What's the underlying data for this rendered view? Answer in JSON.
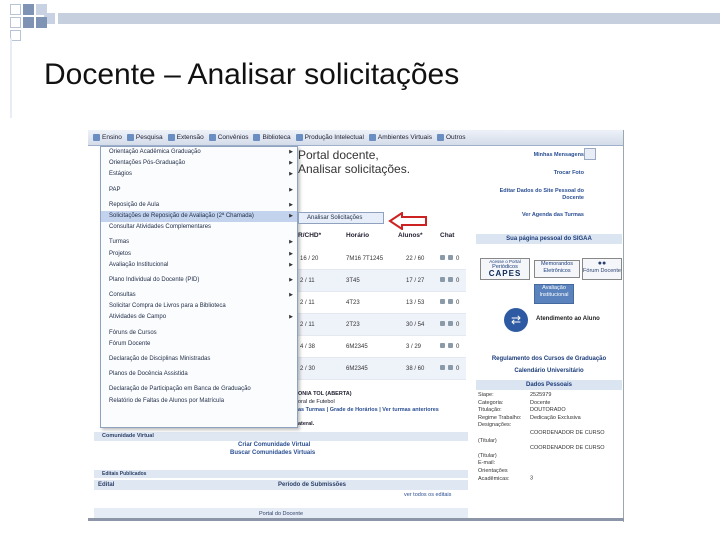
{
  "slide": {
    "title": "Docente – Analisar solicitações",
    "callout": [
      "Portal docente,",
      "Analisar solicitações."
    ]
  },
  "topnav": {
    "items": [
      "Ensino",
      "Pesquisa",
      "Extensão",
      "Convênios",
      "Biblioteca",
      "Produção Intelectual",
      "Ambientes Virtuais",
      "Outros"
    ]
  },
  "menu": {
    "items": [
      {
        "label": "Orientação Acadêmica   Graduação",
        "arrow": true
      },
      {
        "label": "Orientações Pós-Graduação",
        "arrow": true
      },
      {
        "label": "Estágios",
        "arrow": true
      },
      {
        "label": "",
        "arrow": false
      },
      {
        "label": "PAP",
        "arrow": true
      },
      {
        "label": "",
        "arrow": false
      },
      {
        "label": "Reposição de Aula",
        "arrow": true
      },
      {
        "label": "Solicitações de Reposição de Avaliação (2ª Chamada)",
        "arrow": true,
        "highlight": true
      },
      {
        "label": "Consultar Atividades Complementares",
        "arrow": false
      },
      {
        "label": "",
        "arrow": false
      },
      {
        "label": "Turmas",
        "arrow": true
      },
      {
        "label": "Projetos",
        "arrow": true
      },
      {
        "label": "Avaliação Institucional",
        "arrow": true
      },
      {
        "label": "",
        "arrow": false
      },
      {
        "label": "Plano Individual do Docente (PID)",
        "arrow": true
      },
      {
        "label": "",
        "arrow": false
      },
      {
        "label": "Consultas",
        "arrow": true
      },
      {
        "label": "Solicitar Compra de Livros para a Biblioteca",
        "arrow": false
      },
      {
        "label": "Atividades de Campo",
        "arrow": true
      },
      {
        "label": "",
        "arrow": false
      },
      {
        "label": "Fóruns de Cursos",
        "arrow": false
      },
      {
        "label": "Fórum Docente",
        "arrow": false
      },
      {
        "label": "",
        "arrow": false
      },
      {
        "label": "Declaração de Disciplinas Ministradas",
        "arrow": false
      },
      {
        "label": "",
        "arrow": false
      },
      {
        "label": "Planos de Docência Assistida",
        "arrow": false
      },
      {
        "label": "",
        "arrow": false
      },
      {
        "label": "Declaração de Participação em Banca de Graduação",
        "arrow": false
      },
      {
        "label": "Relatório de Faltas de Alunos por Matrícula",
        "arrow": false
      }
    ],
    "submenu_label": "Analisar Solicitações"
  },
  "table": {
    "headers": [
      "R/CHD*",
      "Horário",
      "Alunos*",
      "Chat"
    ],
    "rows": [
      {
        "a": "16 / 20",
        "b": "7M16 7T1245",
        "c": "22 / 60",
        "d": "0"
      },
      {
        "a": "2 / 11",
        "b": "3T45",
        "c": "17 / 27",
        "d": "0"
      },
      {
        "a": "2 / 11",
        "b": "4T23",
        "c": "13 / 53",
        "d": "0"
      },
      {
        "a": "2 / 11",
        "b": "2T23",
        "c": "30 / 54",
        "d": "0"
      },
      {
        "a": "4 / 38",
        "b": "6M2345",
        "c": "3 / 29",
        "d": "0"
      },
      {
        "a": "2 / 30",
        "b": "6M2345",
        "c": "38 / 60",
        "d": "0"
      }
    ],
    "turmas_text": "ONIA   TOL (ABERTA)",
    "turmas_text2": "oral de Futebol",
    "turmas_links": "as Turmas  |  Grade de Horários  |  Ver turmas anteriores",
    "turmas_footer": "ateral."
  },
  "lower": {
    "comunidade_title": "Comunidade Virtual",
    "criar": "Criar Comunidade Virtual",
    "buscar": "Buscar Comunidades Virtuais",
    "editais_title": "Editais Publicados",
    "edital_col": "Edital",
    "periodo_col": "Período de Submissões",
    "ver_todos": "ver todos os editais",
    "portal_footer": "Portal do Docente"
  },
  "right": {
    "links": [
      "Minhas Mensagens",
      "Trocar Foto",
      "Editar Dados do Site Pessoal do Docente",
      "Ver Agenda das Turmas"
    ],
    "pagina_pessoal": "Sua página pessoal do SIGAA",
    "capes_top": "Acesse o Portal",
    "capes_mid": "Periódicos",
    "capes_logo": "CAPES",
    "memo": "Memorandos Eletrônicos",
    "forum": "Fórum Docente",
    "aval": "Avaliação Institucional",
    "atendimento": "Atendimento ao Aluno",
    "regulamento": "Regulamento dos Cursos de Graduação",
    "calendario": "Calendário Universitário",
    "dados_title": "Dados Pessoais",
    "dados": [
      {
        "k": "Siape:",
        "v": "2525979"
      },
      {
        "k": "Categoria:",
        "v": "Docente"
      },
      {
        "k": "Titulação:",
        "v": "DOUTORADO"
      },
      {
        "k": "Regime Trabalho:",
        "v": "Dedicação Exclusiva"
      },
      {
        "k": "Designações:",
        "v": ""
      },
      {
        "k": "",
        "v": "COORDENADOR DE CURSO (Titular)"
      },
      {
        "k": "",
        "v": "COORDENADOR DE CURSO (Titular)"
      },
      {
        "k": "E-mail:",
        "v": ""
      },
      {
        "k": "Orientações Acadêmicas:",
        "v": "3"
      }
    ]
  },
  "colors": {
    "nav_bg": "#d4dcea",
    "menu_highlight": "#c3d3ee",
    "arrow": "#cc2222",
    "link": "#2b4f92"
  }
}
